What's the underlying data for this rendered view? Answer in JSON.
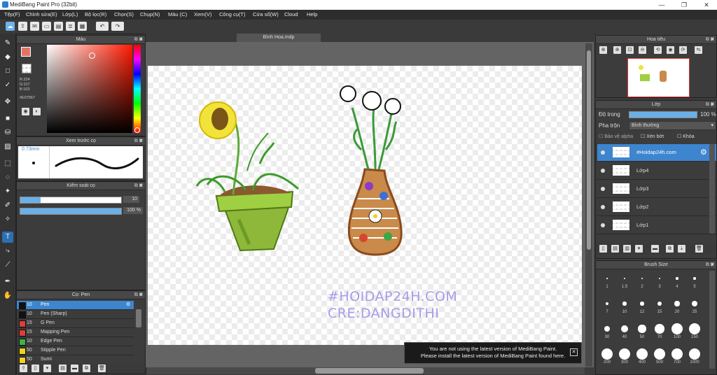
{
  "window": {
    "title": "MediBang Paint Pro (32bit)",
    "minimize": "—",
    "maximize": "❐",
    "close": "✕"
  },
  "menu": [
    "Tệp(F)",
    "Chỉnh sửa(E)",
    "Lớp(L)",
    "Bộ lọc(R)",
    "Chọn(S)",
    "Chụp(N)",
    "Màu (C)",
    "Xem(V)",
    "Công cụ(T)",
    "Cửa sổ(W)",
    "Cloud",
    "Help"
  ],
  "document": {
    "tab_title": "Bình Hoa.mdp"
  },
  "color_panel": {
    "title": "Màu",
    "r": "R:224",
    "g": "G:117",
    "b": "B:103",
    "hex": "#E07567",
    "primary_color": "#e07567"
  },
  "brush_preview": {
    "title": "Xem trước cọ",
    "size": "0.73mm"
  },
  "brush_control": {
    "title": "Kiểm soát cọ",
    "size_value": "10",
    "opacity_value": "100 %",
    "size_fraction": 0.2,
    "opacity_fraction": 1.0
  },
  "brush_list": {
    "title": "Cọ: Pen",
    "items": [
      {
        "num": "10",
        "label": "Pen",
        "color": "#111111"
      },
      {
        "num": "10",
        "label": "Pen (Sharp)",
        "color": "#111111"
      },
      {
        "num": "15",
        "label": "G Pen",
        "color": "#e03c3c"
      },
      {
        "num": "15",
        "label": "Mapping Pen",
        "color": "#e03c3c"
      },
      {
        "num": "10",
        "label": "Edge Pen",
        "color": "#3cb34a"
      },
      {
        "num": "50",
        "label": "Stipple Pen",
        "color": "#f0d020"
      },
      {
        "num": "50",
        "label": "Sumi",
        "color": "#f0d020"
      }
    ]
  },
  "navigator": {
    "title": "Hoa tiêu"
  },
  "layer_panel": {
    "title": "Lớp",
    "opacity_label": "Độ trong",
    "opacity_value": "100 %",
    "opacity_fraction": 1.0,
    "blend_label": "Pha trộn",
    "blend_value": "Bình thường",
    "protect_alpha": "Bảo vệ alpha",
    "clipping": "Xén bớt",
    "lock": "Khóa",
    "layers": [
      "#Hoidap24h.com",
      "Lớp4",
      "Lớp3",
      "Lớp2",
      "Lớp1"
    ]
  },
  "brush_size": {
    "title": "Brush Size",
    "sizes": [
      "1",
      "1.5",
      "2",
      "3",
      "4",
      "5",
      "7",
      "10",
      "12",
      "15",
      "20",
      "25",
      "30",
      "40",
      "50",
      "70",
      "100",
      "150",
      "200",
      "300",
      "400",
      "500",
      "700",
      "1000"
    ]
  },
  "watermark": {
    "line1": "#HOIDAP24H.COM",
    "line2": "CRE:DANGDITHI"
  },
  "notice": {
    "line1": "You are not using the latest version of MediBang Paint.",
    "line2": "Please install the latest version of MediBang Paint found here.",
    "close": "✕"
  }
}
